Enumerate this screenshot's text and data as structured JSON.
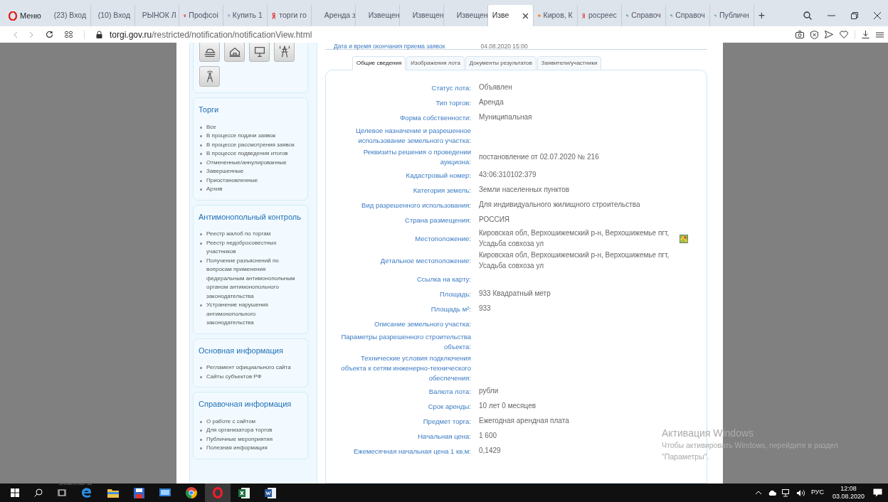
{
  "browser": {
    "menu_label": "Меню",
    "tabs": [
      {
        "kind": "mail",
        "title": "(23) Вход",
        "selected": false
      },
      {
        "kind": "mail",
        "title": "(10) Вход",
        "selected": false
      },
      {
        "kind": "yandex",
        "title": "РЫНОК Л",
        "selected": false
      },
      {
        "kind": "pin",
        "title": "Профсоі",
        "selected": false
      },
      {
        "kind": "dots",
        "title": "Купить 1",
        "selected": false
      },
      {
        "kind": "yandex",
        "title": "торги го",
        "selected": false
      },
      {
        "kind": "none",
        "title": "Аренда з",
        "selected": false
      },
      {
        "kind": "none",
        "title": "Извещен",
        "selected": false
      },
      {
        "kind": "none",
        "title": "Извещен",
        "selected": false
      },
      {
        "kind": "none",
        "title": "Извещен",
        "selected": false
      },
      {
        "kind": "none",
        "title": "Изве",
        "selected": true
      },
      {
        "kind": "sun",
        "title": "Киров, К",
        "selected": false
      },
      {
        "kind": "yandex",
        "title": "росреес",
        "selected": false
      },
      {
        "kind": "leaf",
        "title": "Справоч",
        "selected": false
      },
      {
        "kind": "leaf",
        "title": "Справоч",
        "selected": false
      },
      {
        "kind": "leaf",
        "title": "Публичн",
        "selected": false
      }
    ],
    "new_tab": "+",
    "url_host": "torgi.gov.ru",
    "url_path": "/restricted/notification/notificationView.html"
  },
  "sidebar": {
    "panels": [
      {
        "title": "Торги",
        "items": [
          "Все",
          "В процессе подачи заявок",
          "В процессе рассмотрения заявок",
          "В процессе подведения итогов",
          "Отмененные/аннулированные",
          "Завершенные",
          "Приостановленные",
          "Архив"
        ]
      },
      {
        "title": "Антимонопольный контроль",
        "items": [
          "Реестр жалоб по торгам",
          "Реестр недобросовестных участников",
          "Получение разъяснений по вопросам применения федеральным антимонопольным органом антимонопольного законодательства",
          "Устранение нарушения антимонопольного законодательства"
        ]
      },
      {
        "title": "Основная информация",
        "items": [
          "Регламент официального сайта",
          "Сайты субъектов РФ"
        ]
      },
      {
        "title": "Справочная информация",
        "items": [
          "О работе с сайтом",
          "Для организатора торгов",
          "Публичные мероприятия",
          "Полезная информация"
        ]
      }
    ]
  },
  "top_row": {
    "label": "Дата и время окончания приема заявок",
    "value": "04.08.2020 15:00"
  },
  "tabs": [
    {
      "label": "Общие сведения",
      "selected": true
    },
    {
      "label": "Изображения лота",
      "selected": false
    },
    {
      "label": "Документы результатов",
      "selected": false
    },
    {
      "label": "Заявители/участники",
      "selected": false
    }
  ],
  "rows": [
    {
      "kind": "text",
      "label": "Статус лота:",
      "value": "Объявлен"
    },
    {
      "kind": "text",
      "label": "Тип торгов:",
      "value": "Аренда"
    },
    {
      "kind": "text",
      "label": "Форма собственности:",
      "value": "Муниципальная"
    },
    {
      "kind": "text",
      "label": "Целевое назначение и разрешенное использование земельного участка:"
    },
    {
      "kind": "text",
      "label": "Реквизиты решения о проведении аукциона:",
      "value": "постановление от 02.07.2020 № 216"
    },
    {
      "kind": "text",
      "label": "Кадастровый номер:",
      "value": "43:06:310102:379"
    },
    {
      "kind": "text",
      "label": "Категория земель:",
      "value": "Земли населенных пунктов"
    },
    {
      "kind": "text",
      "label": "Вид разрешенного использования:",
      "value": "Для индивидуального жилищного строительства"
    },
    {
      "kind": "text",
      "label": "Страна размещения:",
      "value": "РОССИЯ"
    },
    {
      "kind": "map",
      "label": "Местоположение:",
      "value": "Кировская обл, Верхошижемский р-н, Верхошижемье пгт, Усадьба совхоза ул"
    },
    {
      "kind": "text",
      "label": "Детальное местоположение:",
      "value": "Кировская обл, Верхошижемский р-н, Верхошижемье пгт, Усадьба совхоза ул"
    },
    {
      "kind": "text",
      "label": "Ссылка на карту:"
    },
    {
      "kind": "text",
      "label": "Площадь:",
      "value": "933 Квадратный метр"
    },
    {
      "kind": "text",
      "label": "Площадь м²:",
      "value": "933"
    },
    {
      "kind": "text",
      "label": "Описание земельного участка:"
    },
    {
      "kind": "text",
      "label": "Параметры разрешенного строительства объекта:"
    },
    {
      "kind": "text",
      "label": "Технические условия подключения объекта к сетям инженерно-технического обеспечения:"
    },
    {
      "kind": "text",
      "label": "Валюта лота:",
      "value": "рубли"
    },
    {
      "kind": "text",
      "label": "Срок аренды:",
      "value": "10 лет  0 месяцев"
    },
    {
      "kind": "text",
      "label": "Предмет торга:",
      "value": "Ежегодная арендная плата"
    },
    {
      "kind": "text",
      "label": "Начальная цена:",
      "value": "1 600"
    },
    {
      "kind": "text",
      "label": "Ежемесячная начальная цена 1 кв.м:",
      "value": "0,1429"
    }
  ],
  "activation": {
    "title": "Активация Windows",
    "text": "Чтобы активировать Windows, перейдите в раздел \"Параметры\"."
  },
  "taskbar": {
    "hidden_status": "Элементов: 11",
    "language": "РУС",
    "time": "12:08",
    "date": "03.08.2020"
  }
}
